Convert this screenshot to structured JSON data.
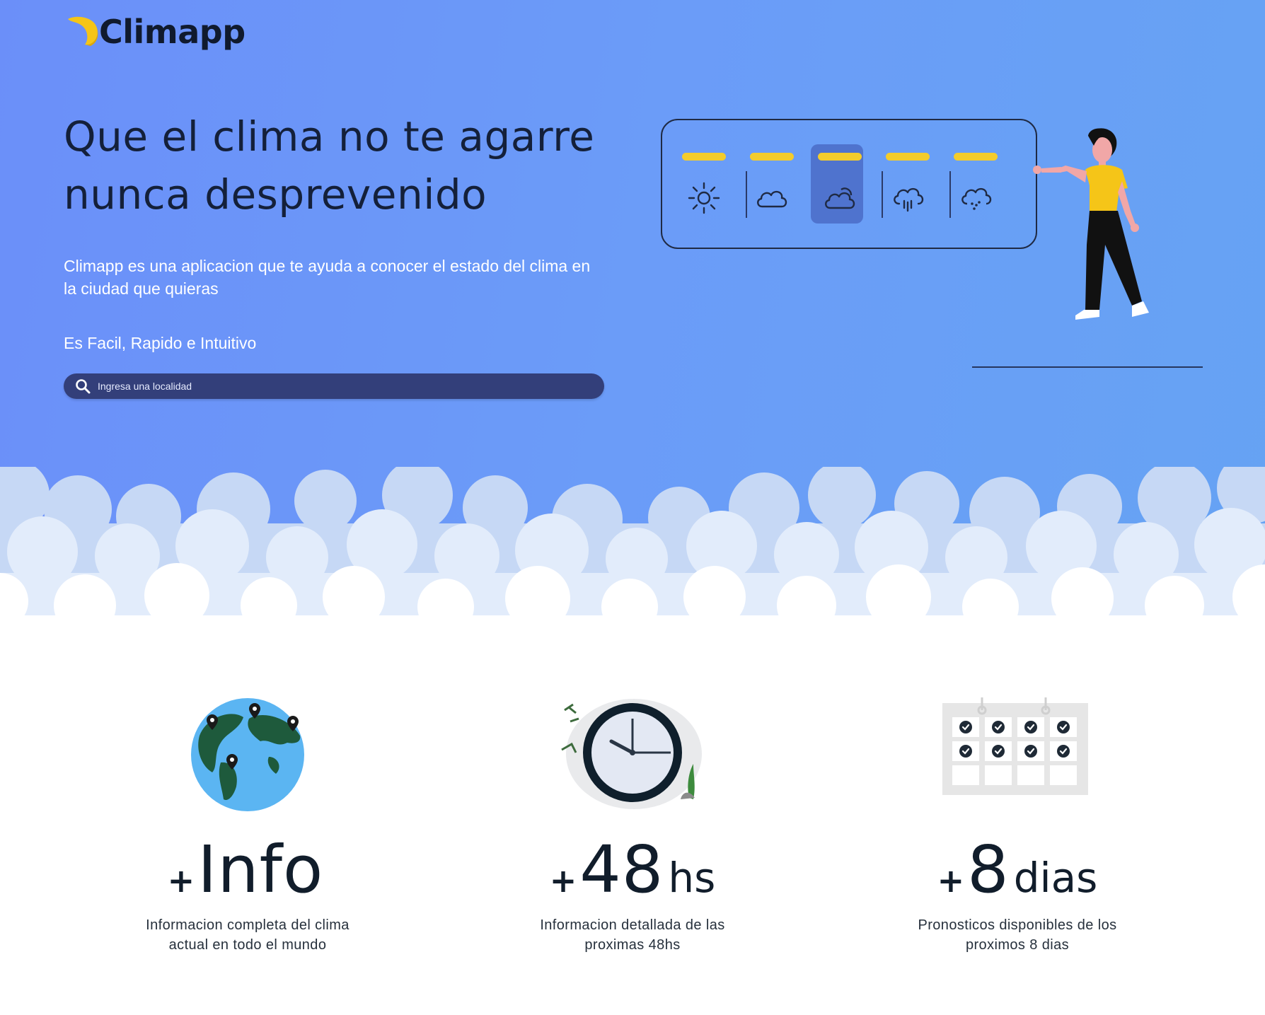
{
  "brand": {
    "name": "Climapp"
  },
  "hero": {
    "headline": "Que el clima no te agarre nunca desprevenido",
    "description": "Climapp es una aplicacion que te ayuda a conocer el estado del clima en la ciudad que quieras",
    "tagline": "Es Facil, Rapido e Intuitivo"
  },
  "search": {
    "placeholder": "Ingresa una localidad"
  },
  "weather_panel": {
    "icons": [
      "sun-icon",
      "cloud-icon",
      "sun-cloud-icon",
      "rain-cloud-icon",
      "snow-cloud-icon"
    ],
    "selected": "sun-cloud-icon"
  },
  "features": [
    {
      "prefix": "+",
      "value": "Info",
      "unit": "",
      "caption_line1": "Informacion completa del clima",
      "caption_line2": "actual en todo el mundo"
    },
    {
      "prefix": "+",
      "value": "48",
      "unit": "hs",
      "caption_line1": "Informacion detallada de las",
      "caption_line2": "proximas 48hs"
    },
    {
      "prefix": "+",
      "value": "8",
      "unit": "dias",
      "caption_line1": "Pronosticos disponibles de los",
      "caption_line2": "proximos 8 dias"
    }
  ],
  "colors": {
    "hero_gradient_start": "#6b8ff9",
    "hero_gradient_end": "#66a3f3",
    "accent_yellow": "#f3cc2c",
    "search_bg": "#333f7a",
    "text_dark": "#14203a"
  }
}
